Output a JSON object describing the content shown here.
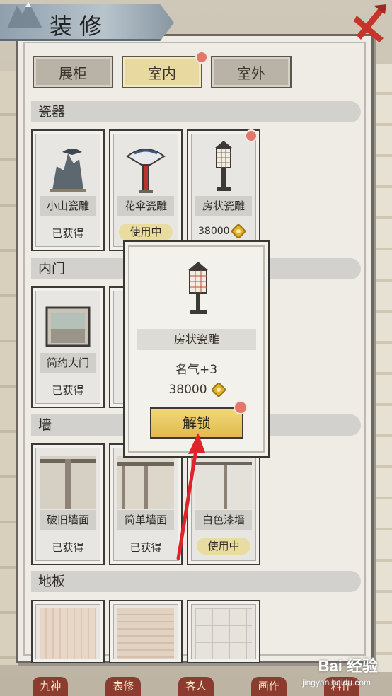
{
  "header": {
    "title": "装修"
  },
  "tabs": [
    {
      "label": "展柜",
      "active": false
    },
    {
      "label": "室内",
      "active": true,
      "badge": true
    },
    {
      "label": "室外",
      "active": false
    }
  ],
  "sections": [
    {
      "title": "瓷器",
      "items": [
        {
          "name": "小山瓷雕",
          "status": "已获得"
        },
        {
          "name": "花伞瓷雕",
          "status": "使用中"
        },
        {
          "name": "房状瓷雕",
          "price": "38000",
          "badge": true
        }
      ]
    },
    {
      "title": "内门",
      "items": [
        {
          "name": "简约大门",
          "status": "已获得"
        }
      ]
    },
    {
      "title": "墙",
      "items": [
        {
          "name": "破旧墙面",
          "status": "已获得"
        },
        {
          "name": "简单墙面",
          "status": "已获得"
        },
        {
          "name": "白色漆墙",
          "status": "使用中"
        }
      ]
    },
    {
      "title": "地板",
      "items": []
    }
  ],
  "popup": {
    "item_name": "房状瓷雕",
    "fame": "名气+3",
    "price": "38000",
    "unlock_label": "解锁"
  },
  "bottom_nav": [
    "九神",
    "表修",
    "客人",
    "画作",
    "料作"
  ],
  "watermark": {
    "main": "Bai 经验",
    "sub": "jingyan.baidu.com"
  },
  "colors": {
    "accent_gold": "#e8d9a0",
    "badge_red": "#e4776b",
    "arrow_red": "#e0222a"
  }
}
